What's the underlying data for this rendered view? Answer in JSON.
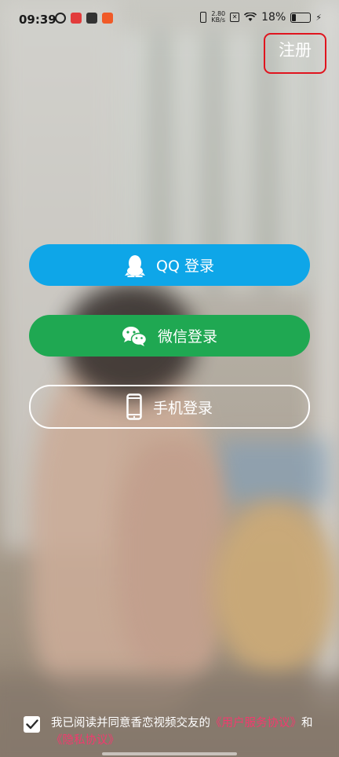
{
  "status_bar": {
    "time": "09:39",
    "network_speed_value": "2.80",
    "network_speed_unit": "KB/s",
    "battery": "18%"
  },
  "header": {
    "register_label": "注册"
  },
  "login_options": [
    {
      "label": "QQ 登录",
      "icon": "qq-penguin-icon",
      "color": "#0ea6e8"
    },
    {
      "label": "微信登录",
      "icon": "wechat-icon",
      "color": "#1fa852"
    },
    {
      "label": "手机登录",
      "icon": "phone-icon",
      "color": "transparent"
    }
  ],
  "agreement": {
    "checked": true,
    "text": "我已阅读并同意香恋视频交友的",
    "user_agreement_link": "《用户服务协议》",
    "connector": "和",
    "privacy_link": "《隐私协议》"
  },
  "colors": {
    "accent_red": "#e0141e",
    "link_pink": "#f23a6e"
  }
}
